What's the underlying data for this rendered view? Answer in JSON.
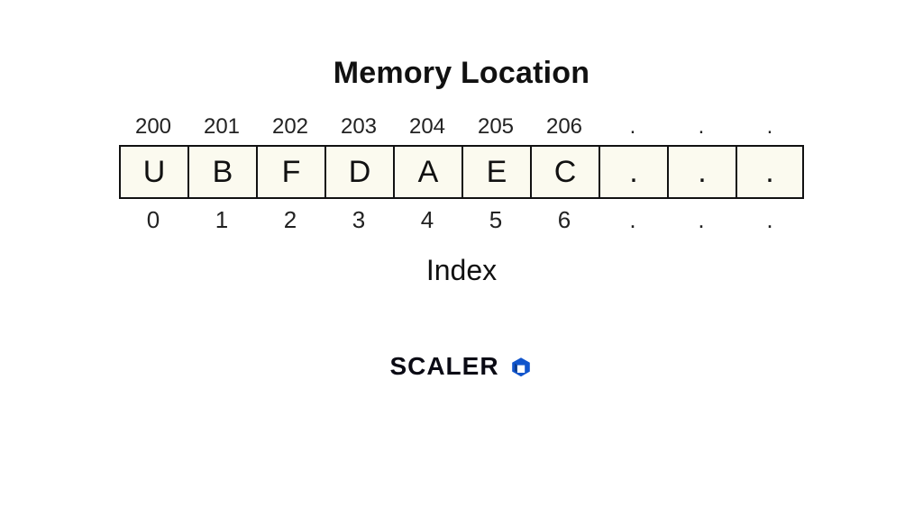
{
  "title": "Memory Location",
  "addresses": [
    "200",
    "201",
    "202",
    "203",
    "204",
    "205",
    "206",
    ".",
    ".",
    "."
  ],
  "values": [
    "U",
    "B",
    "F",
    "D",
    "A",
    "E",
    "C",
    ".",
    ".",
    "."
  ],
  "indices": [
    "0",
    "1",
    "2",
    "3",
    "4",
    "5",
    "6",
    ".",
    ".",
    "."
  ],
  "index_label": "Index",
  "brand": {
    "text": "SCALER",
    "icon": "cube-icon",
    "accent": "#1155cc"
  }
}
